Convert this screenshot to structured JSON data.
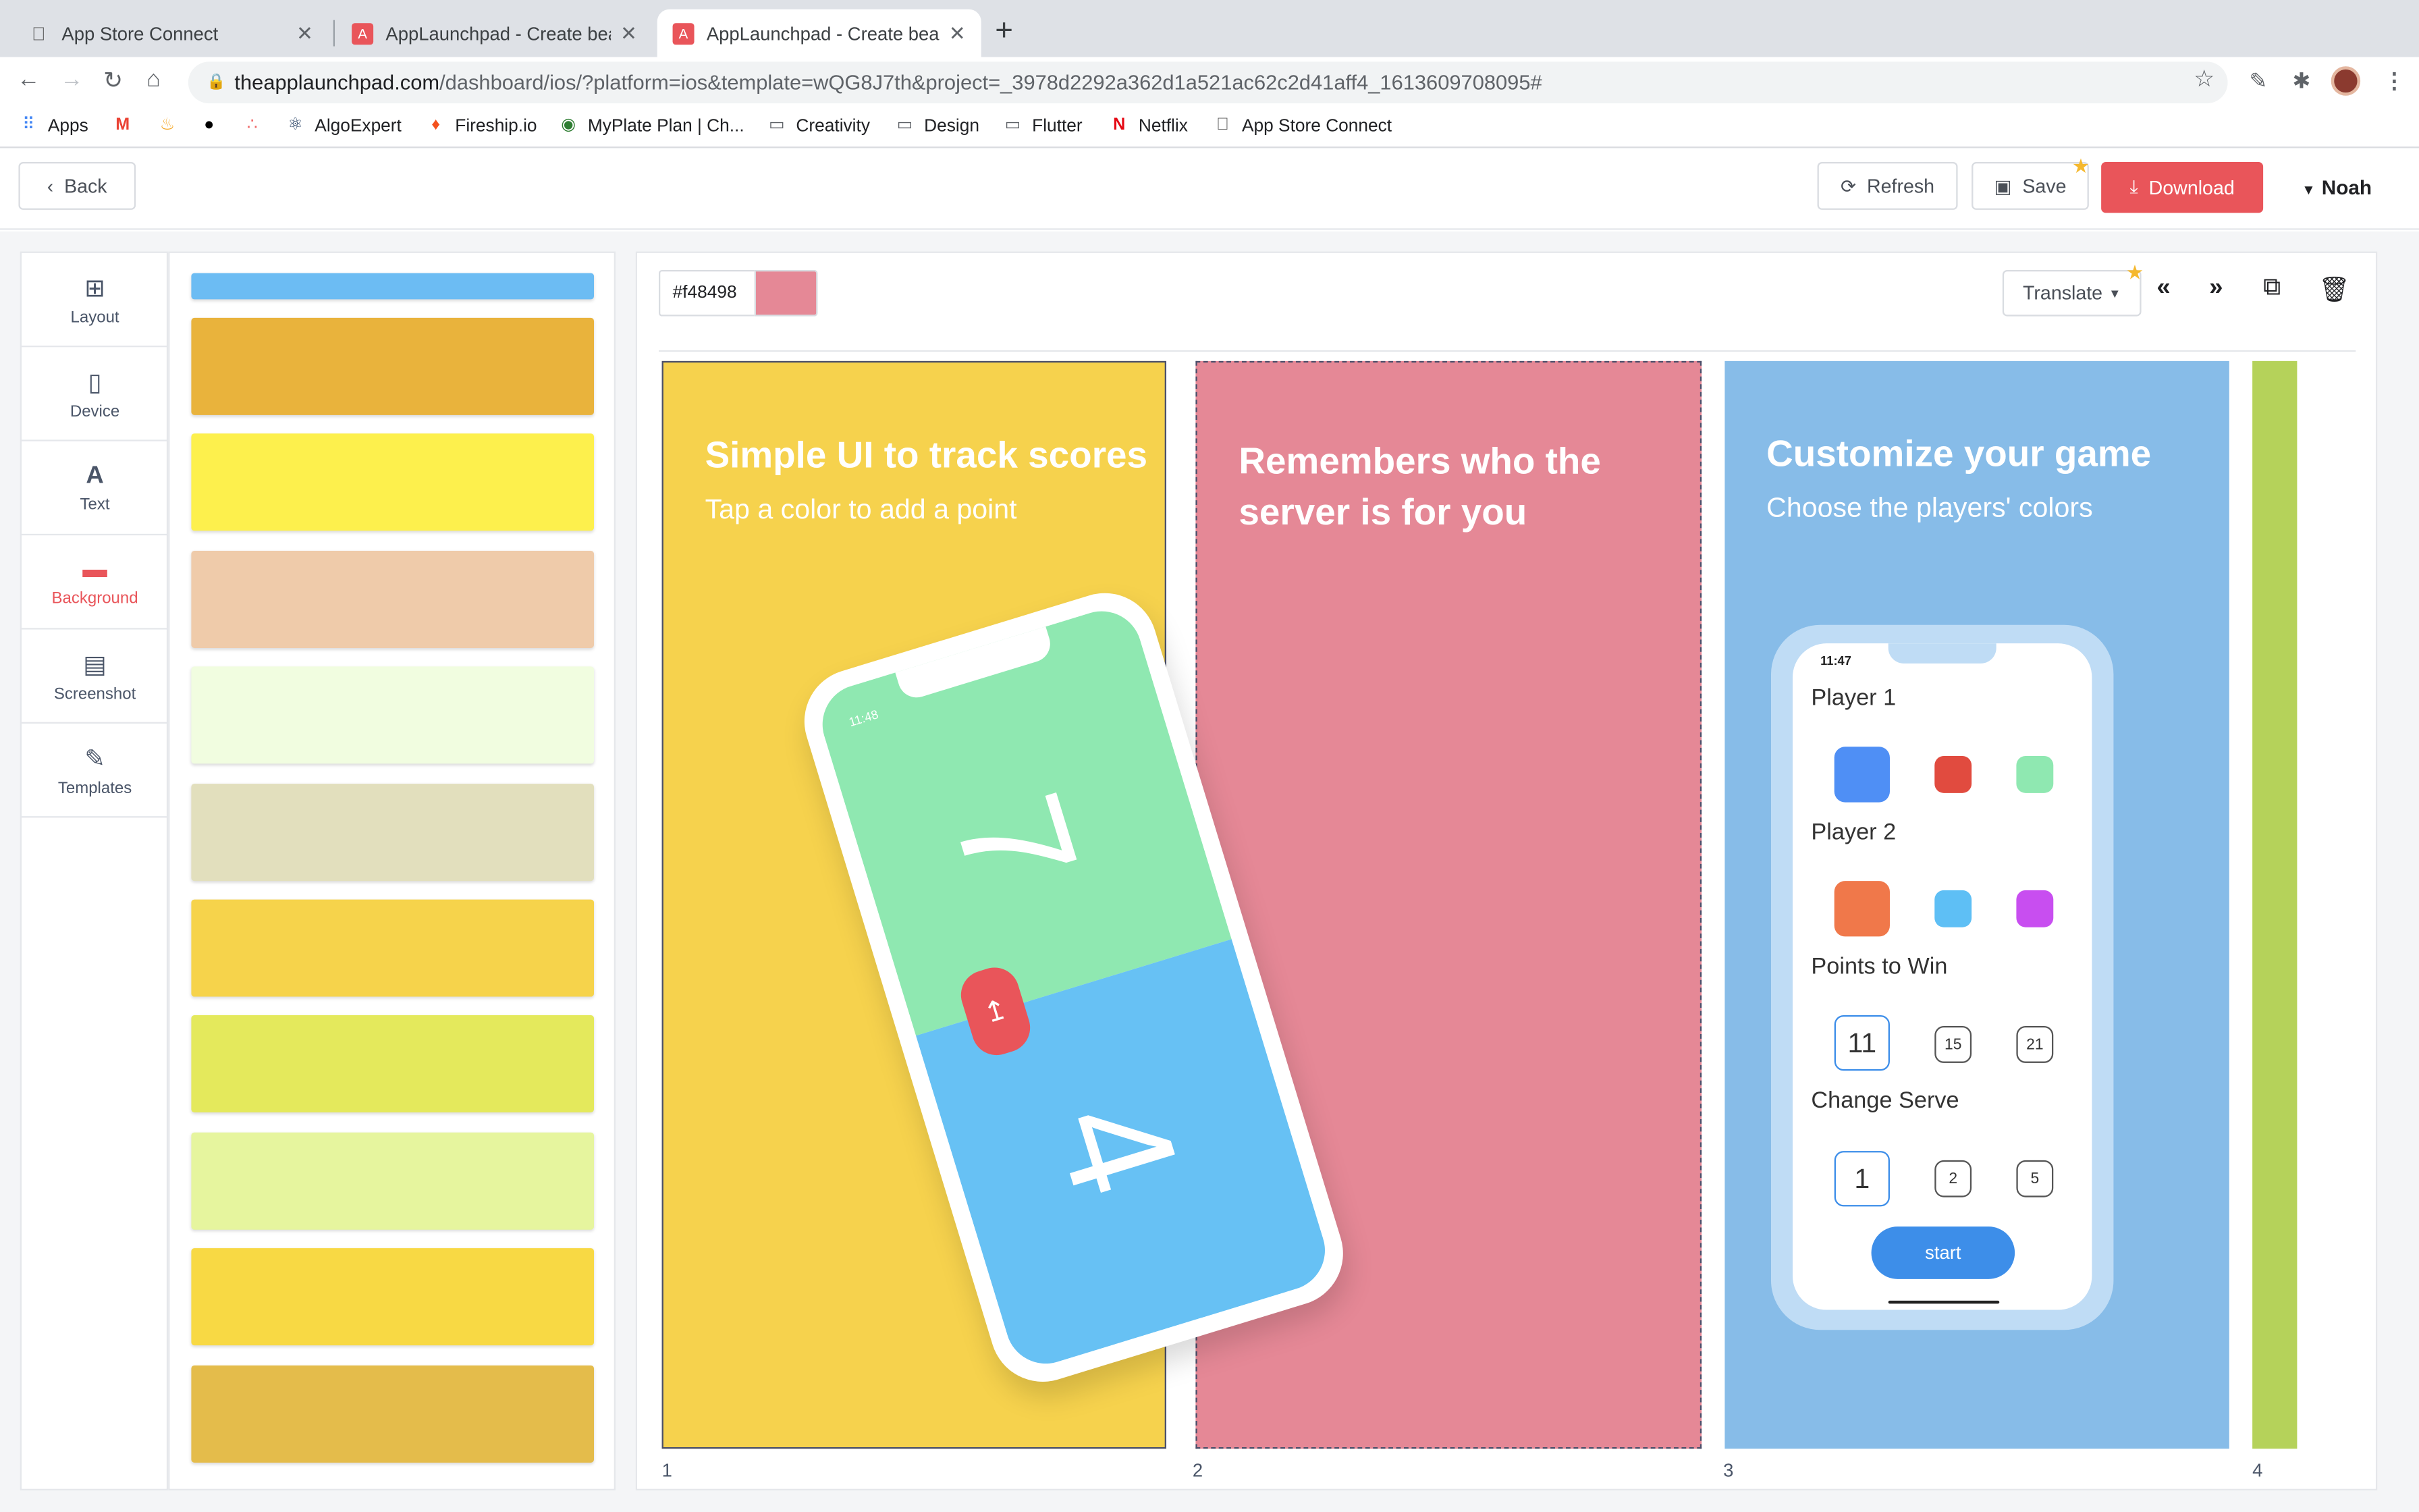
{
  "browser": {
    "tabs": [
      {
        "title": "App Store Connect"
      },
      {
        "title": "AppLaunchpad - Create beauti"
      },
      {
        "title": "AppLaunchpad - Create beauti"
      }
    ],
    "url_domain": "theapplaunchpad.com",
    "url_path": "/dashboard/ios/?platform=ios&template=wQG8J7th&project=_3978d2292a362d1a521ac62c2d41aff4_1613609708095#",
    "bookmarks": [
      "Apps",
      "AlgoExpert",
      "Fireship.io",
      "MyPlate Plan | Ch...",
      "Creativity",
      "Design",
      "Flutter",
      "Netflix",
      "App Store Connect"
    ]
  },
  "header": {
    "back": "Back",
    "refresh": "Refresh",
    "save": "Save",
    "download": "Download",
    "user": "Noah"
  },
  "leftnav": [
    {
      "label": "Layout",
      "icon": "layout-icon"
    },
    {
      "label": "Device",
      "icon": "device-icon"
    },
    {
      "label": "Text",
      "icon": "text-icon"
    },
    {
      "label": "Background",
      "icon": "paint-roller-icon",
      "active": true
    },
    {
      "label": "Screenshot",
      "icon": "screenshot-icon"
    },
    {
      "label": "Templates",
      "icon": "pencil-icon"
    }
  ],
  "swatches": [
    "#6cbcf3",
    "#e9b33c",
    "#fdf04d",
    "#efcbaa",
    "#f1fde0",
    "#e2dfbd",
    "#f6d34b",
    "#e4e95c",
    "#e6f59e",
    "#f8d944",
    "#e4bc4b"
  ],
  "editor": {
    "hex_value": "#f48498",
    "selected_color": "#e58896",
    "translate": "Translate"
  },
  "slides": [
    {
      "number": "1",
      "bg": "#f6d24d",
      "title": "Simple UI to track scores",
      "subtitle": "Tap a color to add a point"
    },
    {
      "number": "2",
      "bg": "#e58896",
      "title_line1": "Remembers who the",
      "title_line2": "server is for you"
    },
    {
      "number": "3",
      "bg": "#87bce8",
      "title": "Customize your game",
      "subtitle": "Choose the players' colors"
    },
    {
      "number": "4",
      "bg": "#b5d25a"
    }
  ],
  "phone1": {
    "time": "11:48",
    "score_top": "7",
    "score_bottom": "4"
  },
  "phone3": {
    "time": "11:47",
    "player1": "Player 1",
    "player2": "Player 2",
    "points_label": "Points to Win",
    "points": [
      "11",
      "15",
      "21"
    ],
    "serve_label": "Change Serve",
    "serve": [
      "1",
      "2",
      "5"
    ],
    "start": "start",
    "p1_colors": [
      "#4f8ff5",
      "#e14b3f",
      "#8fe8b1"
    ],
    "p2_colors": [
      "#f0784a",
      "#5ebff5",
      "#c84ef0"
    ]
  }
}
